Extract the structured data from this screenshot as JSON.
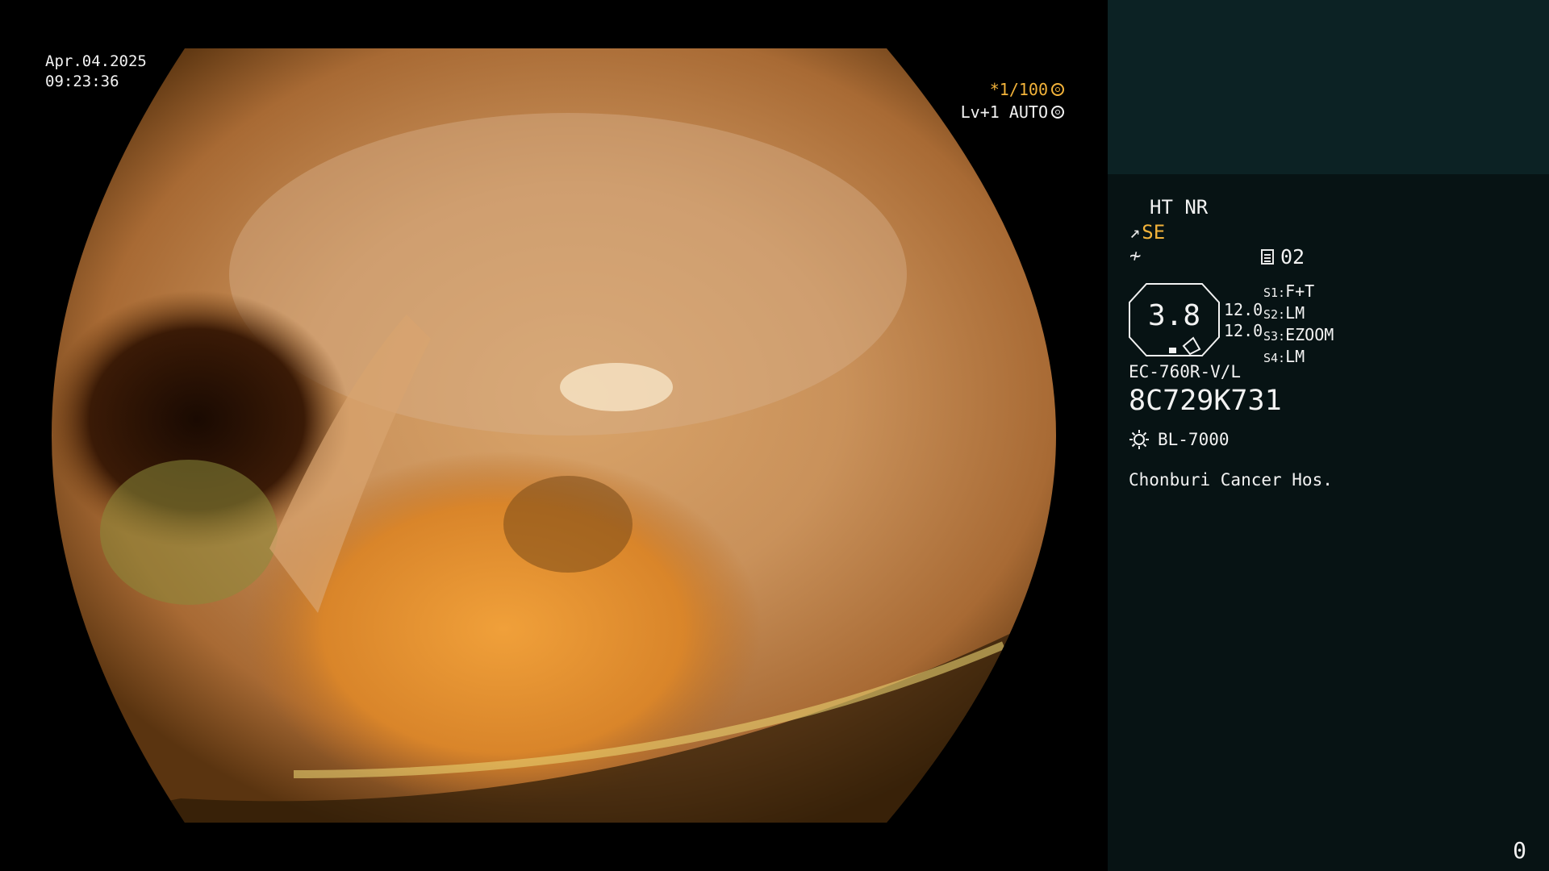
{
  "overlay": {
    "date": "Apr.04.2025",
    "time": "09:23:36",
    "exposure": "*1/100",
    "level": "Lv+1 AUTO"
  },
  "panel": {
    "ht_nr": "HT NR",
    "se_label": "SE",
    "mode_number": "02",
    "octagon_value": "3.8",
    "value_1": "12.0",
    "value_2": "12.0",
    "slots": [
      {
        "key": "S1:",
        "value": "F+T"
      },
      {
        "key": "S2:",
        "value": "LM"
      },
      {
        "key": "S3:",
        "value": "EZOOM"
      },
      {
        "key": "S4:",
        "value": "LM"
      }
    ],
    "scope_model": "EC-760R-V/L",
    "serial": "8C729K731",
    "light_source": "BL-7000",
    "hospital": "Chonburi Cancer Hos.",
    "counter": "0"
  },
  "colors": {
    "accent_orange": "#f3b33a",
    "panel_bg": "#071314",
    "panel_top_bg": "#0c2224"
  },
  "icons": [
    "exposure-icon",
    "auto-icon",
    "pen-icon",
    "structure-icon",
    "document-icon",
    "octagon-icon",
    "sun-icon"
  ]
}
